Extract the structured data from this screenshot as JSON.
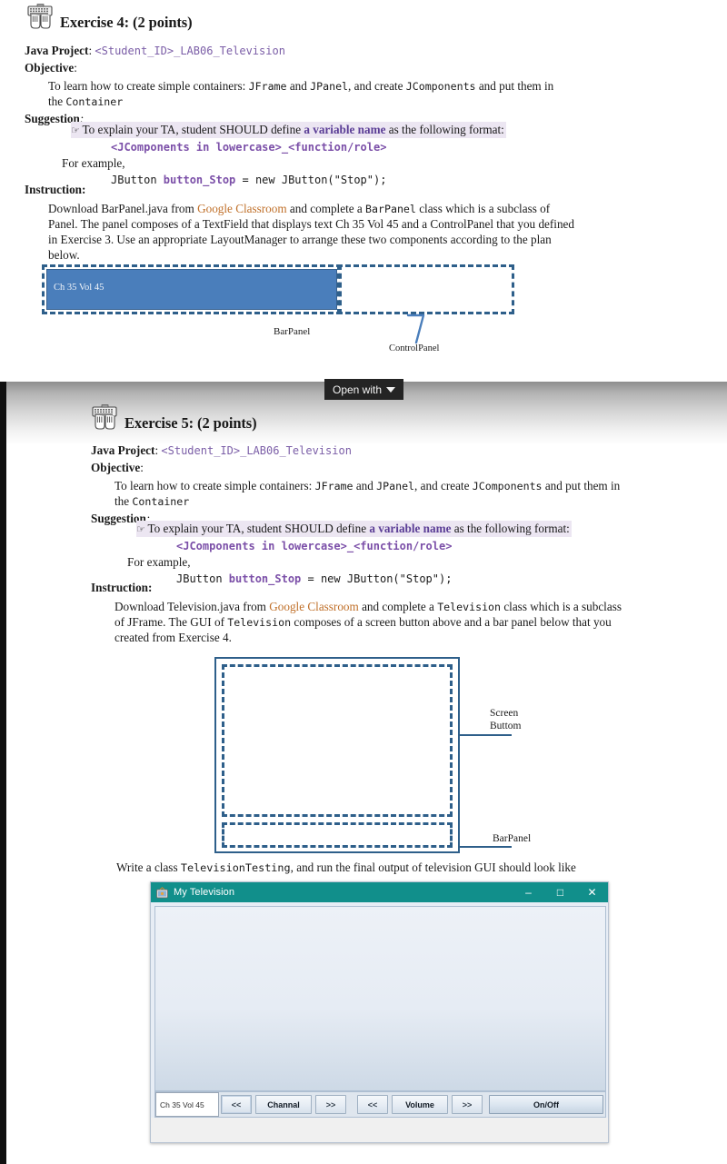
{
  "open_with": {
    "label": "Open with",
    "icon": "chevron-down-icon"
  },
  "exercise_4": {
    "heading": "Exercise 4: (2 points)",
    "icon": "keyboard-hands-icon",
    "java_project_label": "Java Project",
    "java_project_colon": ":",
    "java_project_value": "<Student_ID>_LAB06_Television",
    "objective_label": "Objective",
    "objective_colon": ":",
    "objective_text_a": "To learn how to create simple containers: ",
    "objective_jframe": "JFrame",
    "objective_text_b": " and ",
    "objective_jpanel": "JPanel",
    "objective_text_c": ", and create ",
    "objective_jcomponents": "JComponents",
    "objective_text_d": " and put them in",
    "objective_line2_a": "the ",
    "objective_container": "Container",
    "suggestion_label": "Suggestion",
    "suggestion_colon": ":",
    "suggest_hand": "☞",
    "suggest_text_a": "To explain your TA, student SHOULD define ",
    "suggest_highlight": "a variable name",
    "suggest_text_b": " as the following format:",
    "suggest_format": "<JComponents in lowercase>_<function/role>",
    "for_example": "For example,",
    "example_code_a": "JButton ",
    "example_code_var": "button_Stop",
    "example_code_b": " = new JButton(\"Stop\");",
    "instruction_label": "Instruction:",
    "instr_a": "Download BarPanel.java from ",
    "instr_link": "Google Classroom",
    "instr_b": " and complete a ",
    "instr_class": "BarPanel",
    "instr_c": "  class which is a subclass of",
    "instr_line2": "Panel. The panel composes of a TextField that displays text Ch 35 Vol 45 and a ControlPanel that you defined",
    "instr_line3": "in Exercise 3. Use an appropriate LayoutManager to arrange these two components according to the plan",
    "instr_line4": "below.",
    "diagram": {
      "textfield_label": "Ch 35 Vol 45",
      "barpanel_caption": "BarPanel",
      "controlpanel_caption": "ControlPanel",
      "fill_color": "#4a7ebb",
      "outline_color": "#2e5f8a"
    }
  },
  "exercise_5": {
    "heading": "Exercise 5: (2 points)",
    "icon": "keyboard-hands-icon",
    "java_project_label": "Java Project",
    "java_project_colon": ":",
    "java_project_value": "<Student_ID>_LAB06_Television",
    "objective_label": "Objective",
    "objective_colon": ":",
    "objective_text_a": "To learn how to create simple containers: ",
    "objective_jframe": "JFrame",
    "objective_text_b": " and ",
    "objective_jpanel": "JPanel",
    "objective_text_c": ", and create ",
    "objective_jcomponents": "JComponents",
    "objective_text_d": " and put them in",
    "objective_line2_a": "the ",
    "objective_container": "Container",
    "suggestion_label": "Suggestion",
    "suggestion_colon": ":",
    "suggest_hand": "☞",
    "suggest_text_a": "To explain your TA, student SHOULD define ",
    "suggest_highlight": "a variable name",
    "suggest_text_b": " as the following format:",
    "suggest_format": "<JComponents in lowercase>_<function/role>",
    "for_example": "For example,",
    "example_code_a": "JButton ",
    "example_code_var": "button_Stop",
    "example_code_b": " = new JButton(\"Stop\");",
    "instruction_label": "Instruction:",
    "instr_a": "Download Television.java from ",
    "instr_link": "Google Classroom",
    "instr_b": " and complete a ",
    "instr_class": "Television",
    "instr_c": "  class which is a subclass",
    "instr_line2_a": "of JFrame. The GUI of ",
    "instr_line2_class": "Television",
    "instr_line2_b": "  composes of a screen button above and a bar panel below that you",
    "instr_line3": "created from Exercise 4.",
    "diagram": {
      "screen_label_line1": "Screen",
      "screen_label_line2": "Buttom",
      "barpanel_label": "BarPanel",
      "outline_color": "#2e5f8a"
    },
    "write_class_a": "Write a class ",
    "write_class_mono": "TelevisionTesting",
    "write_class_b": ", and run the final output of television GUI should look like"
  },
  "tv_window": {
    "title": "My Television",
    "app_icon": "television-app-icon",
    "titlebar_color": "#118f8b",
    "minimize": "–",
    "maximize": "□",
    "close": "✕",
    "textfield_value": "Ch 35 Vol 45",
    "buttons": [
      {
        "label": "<<",
        "name": "channel-down-button"
      },
      {
        "label": "Channal",
        "name": "channel-button"
      },
      {
        "label": ">>",
        "name": "channel-up-button"
      },
      {
        "label": "<<",
        "name": "volume-down-button"
      },
      {
        "label": "Volume",
        "name": "volume-button"
      },
      {
        "label": ">>",
        "name": "volume-up-button"
      },
      {
        "label": "On/Off",
        "name": "on-off-button"
      }
    ]
  }
}
